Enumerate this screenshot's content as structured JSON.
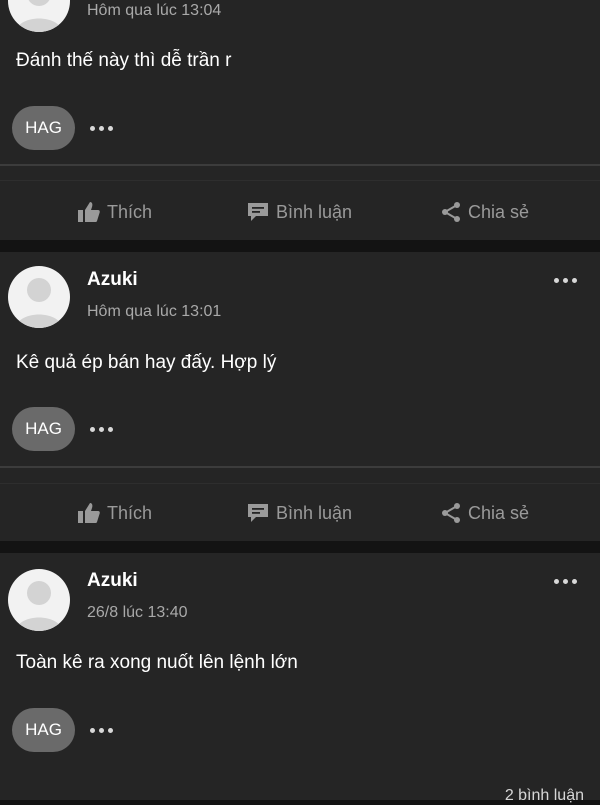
{
  "posts": [
    {
      "author": "",
      "time": "Hôm qua lúc 13:04",
      "content": "Đánh thế này thì dễ trần r",
      "tag": "HAG"
    },
    {
      "author": "Azuki",
      "time": "Hôm qua lúc 13:01",
      "content": "Kê quả ép bán hay đấy. Hợp lý",
      "tag": "HAG"
    },
    {
      "author": "Azuki",
      "time": "26/8 lúc 13:40",
      "content": "Toàn kê ra xong nuốt lên lệnh lớn",
      "tag": "HAG",
      "comment_count": "2 bình luận"
    }
  ],
  "actions": {
    "like_label": "Thích",
    "comment_label": "Bình luận",
    "share_label": "Chia sẻ",
    "like_icon": "thumbs-up-icon",
    "comment_icon": "comment-bubble-icon",
    "share_icon": "share-icon"
  },
  "icons": {
    "avatar": "default-user-avatar",
    "more": "more-dots-icon"
  }
}
